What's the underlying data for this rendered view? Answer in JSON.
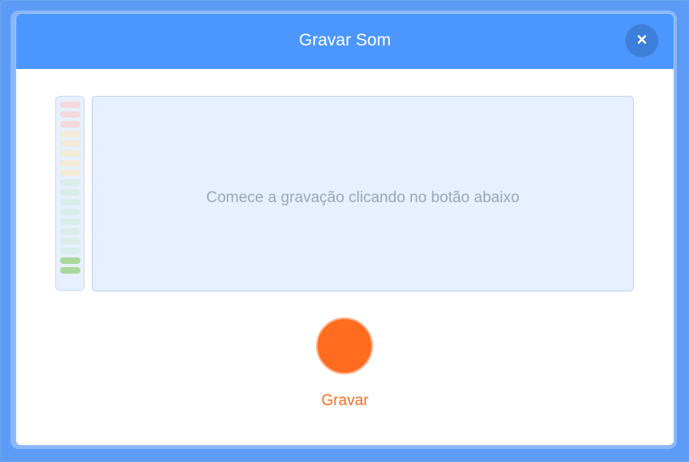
{
  "dialog": {
    "title": "Gravar Som",
    "hint": "Comece a gravação clicando no botão abaixo",
    "record_label": "Gravar"
  },
  "icons": {
    "close": "close-icon"
  },
  "colors": {
    "header": "#4c97ff",
    "record": "#ff6b1f",
    "meter_red": "#f3d9dc",
    "meter_yellow": "#f4ead7",
    "meter_teal": "#d8ece8",
    "meter_green": "#a9d89b"
  }
}
